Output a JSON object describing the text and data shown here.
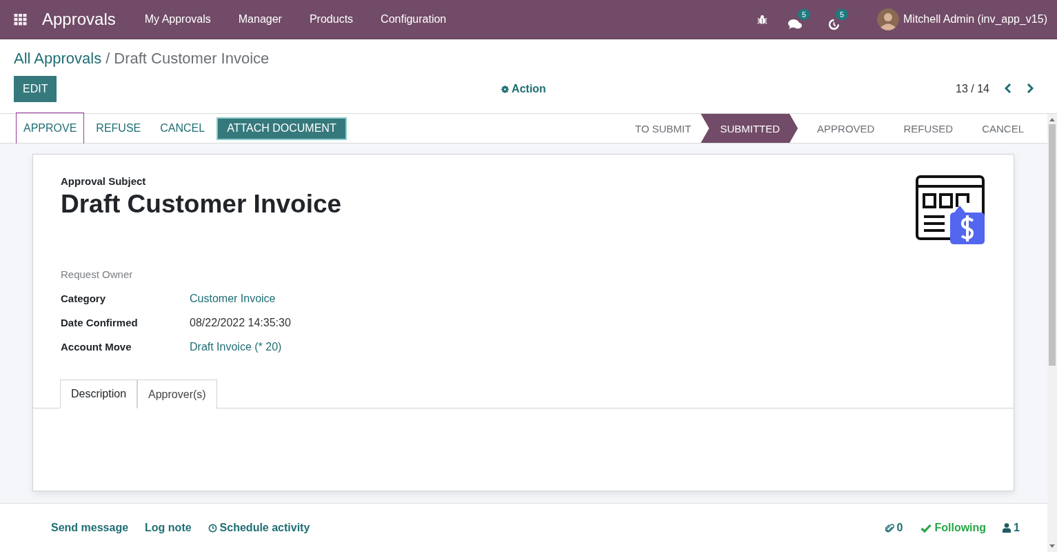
{
  "navbar": {
    "app_name": "Approvals",
    "menu": [
      "My Approvals",
      "Manager",
      "Products",
      "Configuration"
    ],
    "messages_count": "5",
    "activities_count": "5",
    "user": "Mitchell Admin (inv_app_v15)"
  },
  "breadcrumb": {
    "parent": "All Approvals",
    "separator": "/",
    "current": "Draft Customer Invoice"
  },
  "edit_button": "EDIT",
  "action": "Action",
  "pager": "13 / 14",
  "status_buttons": [
    {
      "label": "APPROVE",
      "kind": "link",
      "focused": true
    },
    {
      "label": "REFUSE",
      "kind": "link",
      "focused": false
    },
    {
      "label": "CANCEL",
      "kind": "link",
      "focused": false
    },
    {
      "label": "ATTACH DOCUMENT",
      "kind": "primary",
      "focused": true
    }
  ],
  "stages": [
    {
      "label": "TO SUBMIT",
      "selected": false
    },
    {
      "label": "SUBMITTED",
      "selected": true
    },
    {
      "label": "APPROVED",
      "selected": false
    },
    {
      "label": "REFUSED",
      "selected": false
    },
    {
      "label": "CANCEL",
      "selected": false
    }
  ],
  "sheet": {
    "subject_label": "Approval Subject",
    "title": "Draft Customer Invoice",
    "fields": [
      {
        "label": "Request Owner",
        "kind": "empty"
      },
      {
        "label": "Category",
        "kind": "link",
        "value": "Customer Invoice"
      },
      {
        "label": "Date Confirmed",
        "kind": "text",
        "value": "08/22/2022 14:35:30"
      },
      {
        "label": "Account Move",
        "kind": "link",
        "value": "Draft Invoice (* 20)"
      }
    ],
    "tabs": [
      {
        "label": "Description",
        "selected": true
      },
      {
        "label": "Approver(s)",
        "selected": false
      }
    ]
  },
  "chatter": {
    "actions": [
      {
        "label": "Send message",
        "kind": "plain"
      },
      {
        "label": "Log note",
        "kind": "plain"
      },
      {
        "label": "Schedule activity",
        "kind": "activity"
      }
    ],
    "attachments": "0",
    "follow": "Following",
    "followers": "1"
  }
}
